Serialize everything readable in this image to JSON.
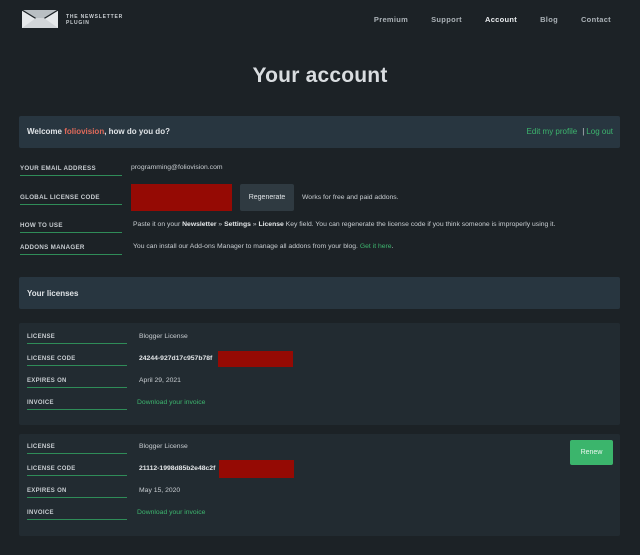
{
  "brand": {
    "line1": "THE NEWSLETTER",
    "line2": "PLUGIN"
  },
  "nav": [
    {
      "label": "Premium",
      "active": false
    },
    {
      "label": "Support",
      "active": false
    },
    {
      "label": "Account",
      "active": true
    },
    {
      "label": "Blog",
      "active": false
    },
    {
      "label": "Contact",
      "active": false
    }
  ],
  "page_title": "Your account",
  "welcome": {
    "prefix": "Welcome ",
    "user": "foliovision",
    "suffix": ", how do you do?",
    "edit_profile": "Edit my profile",
    "separator": "|",
    "logout": "Log out"
  },
  "account": {
    "email_label": "YOUR EMAIL ADDRESS",
    "email_value": "programming@foliovision.com",
    "license_label": "GLOBAL LICENSE CODE",
    "regenerate": "Regenerate",
    "license_note": "Works for free and paid addons.",
    "howto_label": "HOW TO USE",
    "howto_1": "Paste it on your ",
    "howto_b1": "Newsletter",
    "howto_2": " » ",
    "howto_b2": "Settings",
    "howto_3": " » ",
    "howto_b3": "License",
    "howto_4": " Key field. You can regenerate the license code if you think someone is improperly using it.",
    "addons_label": "ADDONS MANAGER",
    "addons_text": "You can install our Add-ons Manager to manage all addons from your blog. ",
    "addons_link": "Get it here",
    "addons_end": "."
  },
  "licenses_title": "Your licenses",
  "license_labels": {
    "license": "LICENSE",
    "code": "LICENSE CODE",
    "expires": "EXPIRES ON",
    "invoice": "INVOICE"
  },
  "licenses": [
    {
      "type": "Blogger License",
      "code": "24244-927d17c957b78f",
      "expires": "April 29, 2021",
      "invoice": "Download your invoice"
    },
    {
      "type": "Blogger License",
      "code": "21112-1998d85b2e48c2f",
      "expires": "May 15, 2020",
      "invoice": "Download your invoice",
      "renew": "Renew"
    }
  ],
  "colors": {
    "accent": "#3db56e",
    "username": "#e06a5a",
    "redaction": "#950a04",
    "background": "#1c2226"
  }
}
